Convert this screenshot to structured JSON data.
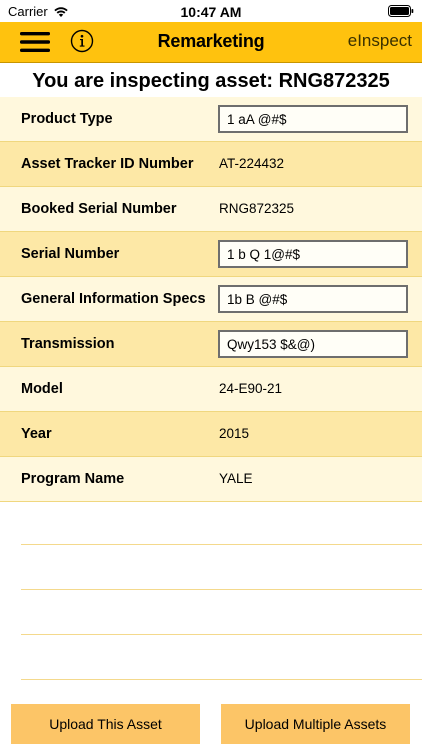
{
  "status_bar": {
    "carrier": "Carrier",
    "time": "10:47 AM"
  },
  "nav": {
    "title": "Remarketing",
    "brand": "eInspect",
    "menu_icon": "hamburger-menu-icon",
    "info_icon": "info-icon",
    "accent_color": "#ffc20e"
  },
  "heading": "You are inspecting asset: RNG872325",
  "rows": [
    {
      "label": "Product Type",
      "type": "input",
      "value": "1 aA @#$"
    },
    {
      "label": "Asset Tracker ID Number",
      "type": "text",
      "value": "AT-224432"
    },
    {
      "label": "Booked Serial Number",
      "type": "text",
      "value": "RNG872325"
    },
    {
      "label": "Serial Number",
      "type": "input",
      "value": "1 b Q 1@#$"
    },
    {
      "label": "General Information Specs",
      "type": "input",
      "value": "1b B @#$"
    },
    {
      "label": "Transmission",
      "type": "input",
      "value": "Qwy153 $&@)"
    },
    {
      "label": "Model",
      "type": "text",
      "value": "24-E90-21"
    },
    {
      "label": "Year",
      "type": "text",
      "value": "2015"
    },
    {
      "label": "Program Name",
      "type": "text",
      "value": "YALE"
    }
  ],
  "buttons": {
    "upload": "Upload This Asset",
    "upload_multiple": "Upload Multiple Assets"
  },
  "colors": {
    "row_light": "#fff8dd",
    "row_dark": "#fde8a6",
    "button": "#fcc567"
  }
}
